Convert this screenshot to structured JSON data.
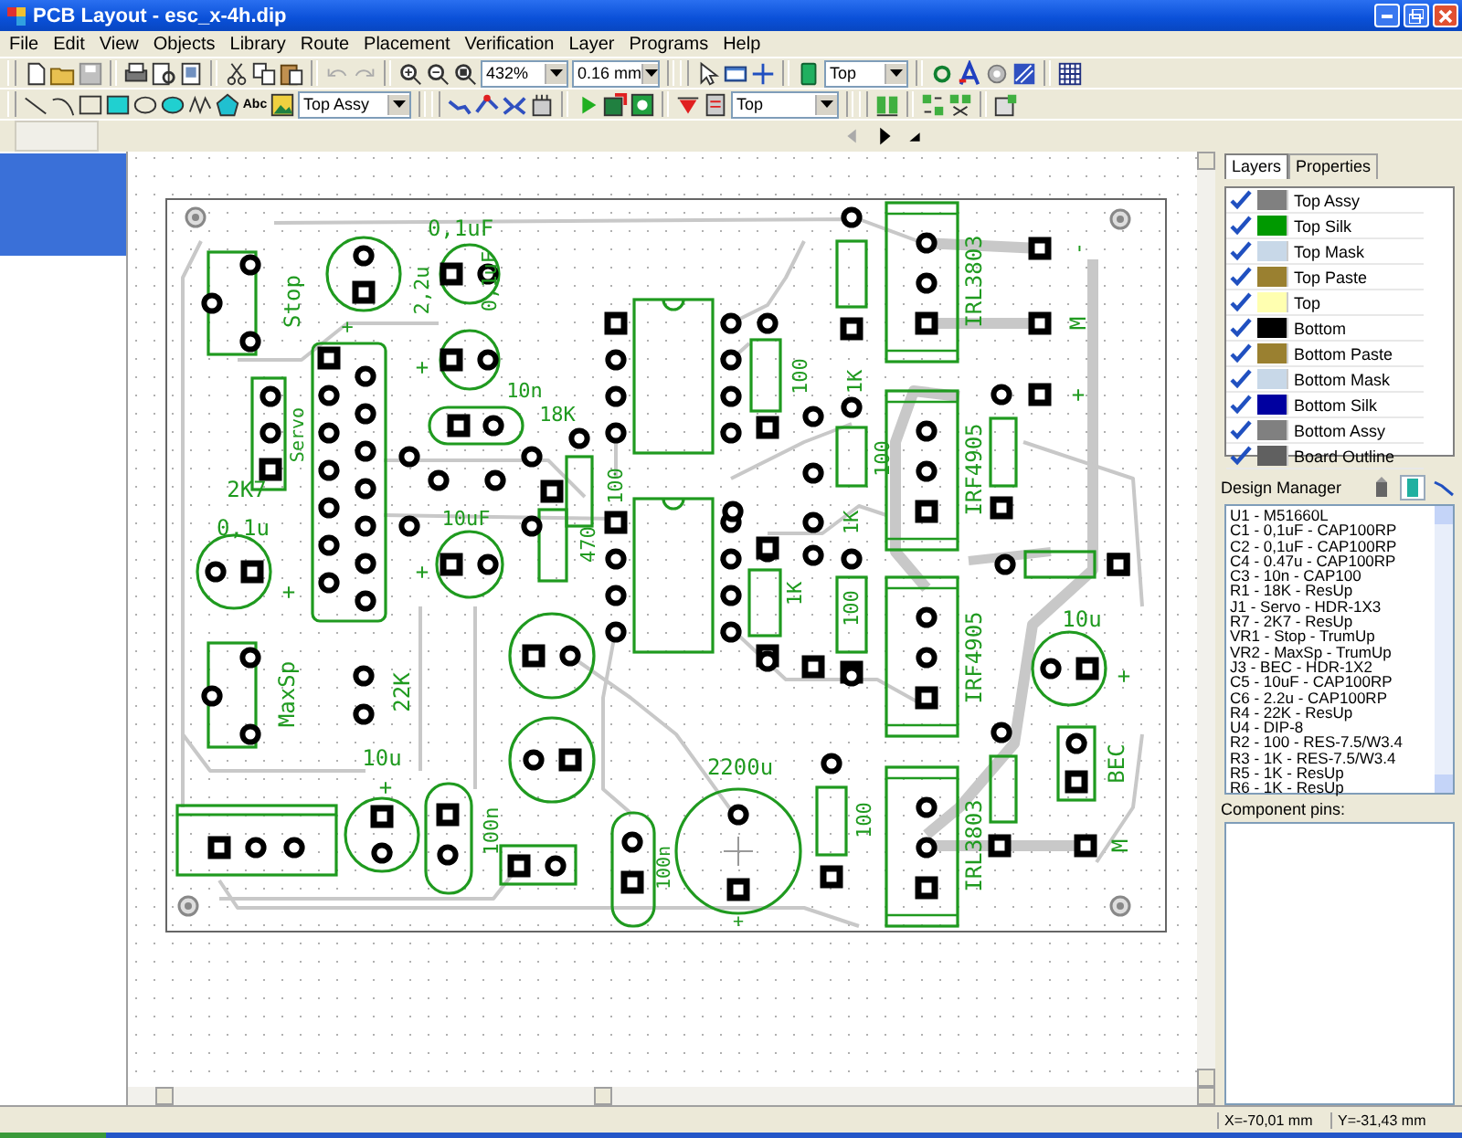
{
  "window": {
    "title": "PCB Layout - esc_x-4h.dip"
  },
  "menu": [
    "File",
    "Edit",
    "View",
    "Objects",
    "Library",
    "Route",
    "Placement",
    "Verification",
    "Layer",
    "Programs",
    "Help"
  ],
  "toolbar": {
    "zoom": "432%",
    "track_width": "0.16 mm",
    "layer": "Top"
  },
  "toolbar_2": {
    "text_tool": "Abc",
    "layer": "Top Assy",
    "layer_2": "Top"
  },
  "board": {
    "labels": [
      "0,1uF",
      "Stop",
      "2,2u",
      "0,1uF",
      "10n",
      "18K",
      "Servo",
      "2K7",
      "0,1u",
      "10uF",
      "470",
      "100",
      "100",
      "1K",
      "1K",
      "100",
      "1K",
      "100",
      "IRL3803",
      "IRF4905",
      "IRF4905",
      "IRL3803",
      "-",
      "M",
      "+",
      "10u",
      "BEC",
      "M",
      "MaxSp",
      "22K",
      "10u",
      "100n",
      "100n",
      "2200u",
      "100",
      "+",
      "+",
      "+",
      "+",
      "+",
      "+",
      "+"
    ]
  },
  "panel": {
    "tabs": [
      {
        "label": "Layers",
        "selected": true
      },
      {
        "label": "Properties",
        "selected": false
      }
    ],
    "layers": [
      {
        "name": "Top Assy",
        "checked": true,
        "color": "#808080"
      },
      {
        "name": "Top Silk",
        "checked": true,
        "color": "#009900"
      },
      {
        "name": "Top Mask",
        "checked": true,
        "color": "#c8d8e8"
      },
      {
        "name": "Top Paste",
        "checked": true,
        "color": "#9a8030"
      },
      {
        "name": "Top",
        "checked": true,
        "color": "#ffffb0"
      },
      {
        "name": "Bottom",
        "checked": true,
        "color": "#000000"
      },
      {
        "name": "Bottom Paste",
        "checked": true,
        "color": "#9a8030"
      },
      {
        "name": "Bottom Mask",
        "checked": true,
        "color": "#c8d8e8"
      },
      {
        "name": "Bottom Silk",
        "checked": true,
        "color": "#0000a0"
      },
      {
        "name": "Bottom Assy",
        "checked": true,
        "color": "#808080"
      },
      {
        "name": "Board Outline",
        "checked": true,
        "color": "#606060"
      }
    ],
    "design_manager": {
      "title": "Design Manager",
      "items": [
        "U1 - M51660L",
        "C1 - 0,1uF - CAP100RP",
        "C2 - 0,1uF - CAP100RP",
        "C4 - 0.47u - CAP100RP",
        "C3 - 10n - CAP100",
        "R1 - 18K - ResUp",
        "J1 - Servo - HDR-1X3",
        "R7 - 2K7 - ResUp",
        "VR1 - Stop - TrumUp",
        "VR2 - MaxSp - TrumUp",
        "J3 - BEC - HDR-1X2",
        "C5 - 10uF - CAP100RP",
        "C6 - 2.2u - CAP100RP",
        "R4 - 22K - ResUp",
        "U4 - DIP-8",
        "R2 - 100 - RES-7.5/W3.4",
        "R3 - 1K - RES-7.5/W3.4",
        "R5 - 1K - ResUp",
        "R6 - 1K - ResUp"
      ]
    },
    "component_pins": {
      "title": "Component pins:"
    }
  },
  "status_bar": {
    "x": "X=-70,01 mm",
    "y": "Y=-31,43 mm"
  }
}
